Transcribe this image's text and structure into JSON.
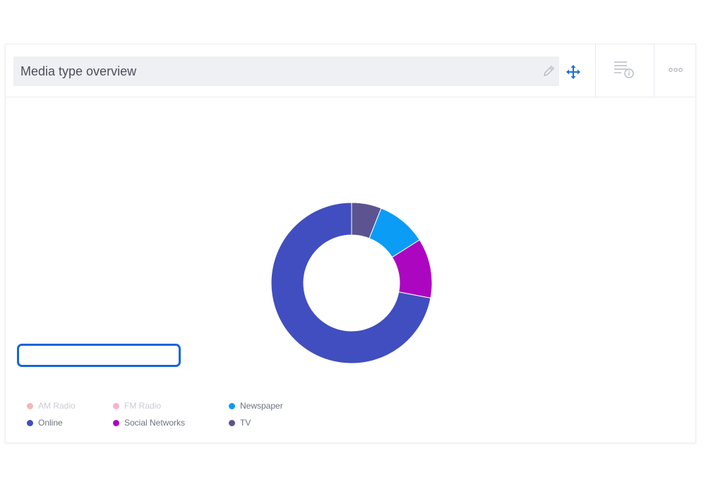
{
  "widget": {
    "title": "Media type overview"
  },
  "icons": {
    "edit": "pencil-icon",
    "move": "move-arrows-icon",
    "info": "list-info-icon",
    "more": "more-dots-icon"
  },
  "colors": {
    "title_bg": "#eff0f3",
    "accent": "#1565d8",
    "highlight": "#1565d8"
  },
  "chart_data": {
    "type": "pie",
    "variant": "donut",
    "slices": [
      {
        "label": "TV",
        "value": 6,
        "color": "#5b5490"
      },
      {
        "label": "Newspaper",
        "value": 10,
        "color": "#0b9cf6"
      },
      {
        "label": "Social Networks",
        "value": 12,
        "color": "#ac06c0"
      },
      {
        "label": "Online",
        "value": 72,
        "color": "#414ebf"
      }
    ],
    "legend": {
      "placement": "bottom-left",
      "items": [
        {
          "label": "AM Radio",
          "color": "#f3b7b9",
          "hidden": true
        },
        {
          "label": "FM Radio",
          "color": "#f7b3cd",
          "hidden": true
        },
        {
          "label": "Newspaper",
          "color": "#0b9cf6",
          "hidden": false
        },
        {
          "label": "Online",
          "color": "#414ebf",
          "hidden": false
        },
        {
          "label": "Social Networks",
          "color": "#ac06c0",
          "hidden": false
        },
        {
          "label": "TV",
          "color": "#5b5490",
          "hidden": false
        }
      ]
    }
  }
}
